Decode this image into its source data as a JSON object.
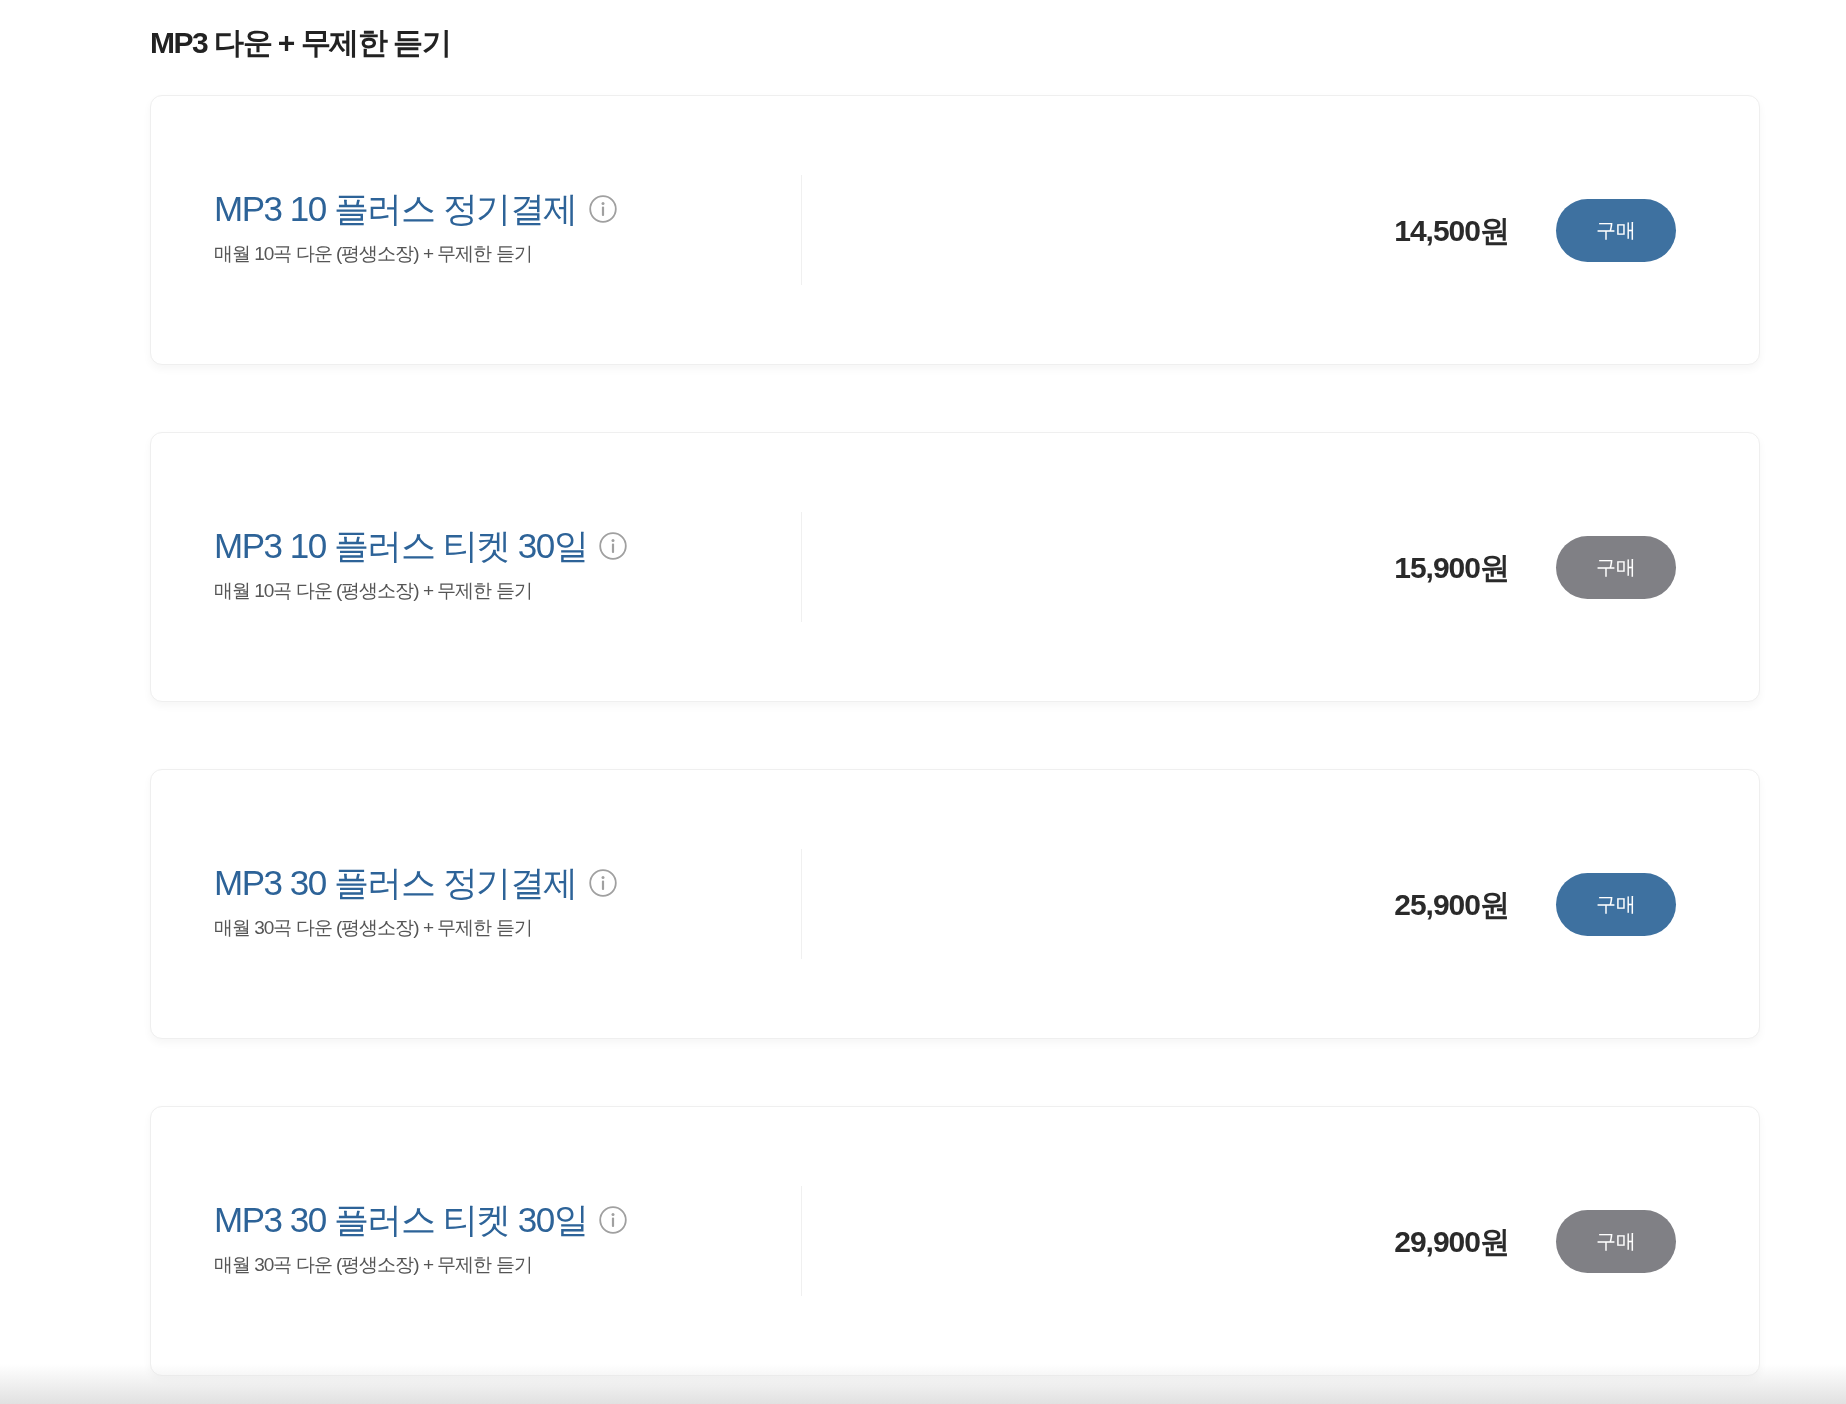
{
  "section": {
    "title": "MP3 다운 + 무제한 듣기"
  },
  "products": [
    {
      "name": "MP3 10 플러스 정기결제",
      "description": "매월 10곡 다운 (평생소장) + 무제한 듣기",
      "price": "14,500원",
      "button": {
        "label": "구매",
        "disabled": false
      }
    },
    {
      "name": "MP3 10 플러스 티켓 30일",
      "description": "매월 10곡 다운 (평생소장) + 무제한 듣기",
      "price": "15,900원",
      "button": {
        "label": "구매",
        "disabled": true
      }
    },
    {
      "name": "MP3 30 플러스 정기결제",
      "description": "매월 30곡 다운 (평생소장) + 무제한 듣기",
      "price": "25,900원",
      "button": {
        "label": "구매",
        "disabled": false
      }
    },
    {
      "name": "MP3 30 플러스 티켓 30일",
      "description": "매월 30곡 다운 (평생소장) + 무제한 듣기",
      "price": "29,900원",
      "button": {
        "label": "구매",
        "disabled": true
      }
    }
  ]
}
